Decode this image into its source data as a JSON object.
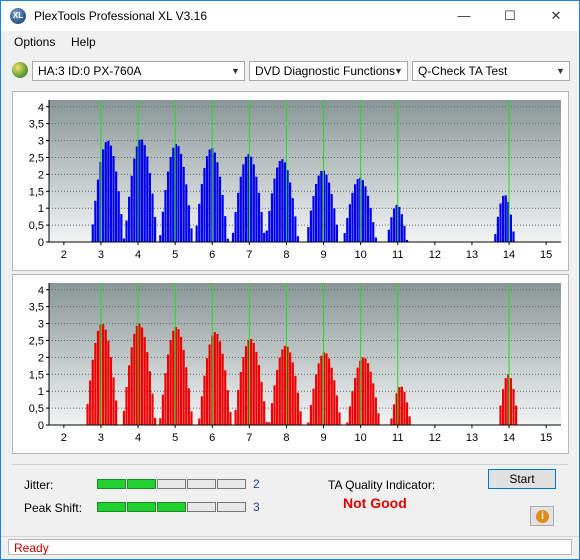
{
  "window": {
    "app_icon_text": "XL",
    "title": "PlexTools Professional XL V3.16",
    "minimize": "—",
    "maximize": "☐",
    "close": "✕"
  },
  "menu": {
    "items": [
      "Options",
      "Help"
    ]
  },
  "toolbar": {
    "drive": "HA:3 ID:0  PX-760A",
    "function": "DVD Diagnostic Functions",
    "test": "Q-Check TA Test"
  },
  "chart_data": [
    {
      "type": "bar",
      "name": "lands",
      "color": "#0000ee",
      "x_ticks": [
        2,
        3,
        4,
        5,
        6,
        7,
        8,
        9,
        10,
        11,
        12,
        13,
        14,
        15
      ],
      "y_ticks": [
        "0",
        "0,5",
        "1",
        "1,5",
        "2",
        "2,5",
        "3",
        "3,5",
        "4"
      ],
      "xlim": [
        1.6,
        15.4
      ],
      "ylim": [
        0,
        4.2
      ],
      "markers": [
        3,
        4,
        5,
        6,
        7,
        8,
        9,
        10,
        11,
        14
      ],
      "peaks": [
        {
          "center": 3.15,
          "height": 3.0
        },
        {
          "center": 4.05,
          "height": 3.05
        },
        {
          "center": 5.0,
          "height": 2.9
        },
        {
          "center": 5.95,
          "height": 2.78
        },
        {
          "center": 6.95,
          "height": 2.6
        },
        {
          "center": 7.85,
          "height": 2.45
        },
        {
          "center": 8.95,
          "height": 2.12
        },
        {
          "center": 9.95,
          "height": 1.9
        },
        {
          "center": 10.95,
          "height": 1.1
        },
        {
          "center": 13.85,
          "height": 1.4
        }
      ]
    },
    {
      "type": "bar",
      "name": "pits",
      "color": "#ee0000",
      "x_ticks": [
        2,
        3,
        4,
        5,
        6,
        7,
        8,
        9,
        10,
        11,
        12,
        13,
        14,
        15
      ],
      "y_ticks": [
        "0",
        "0,5",
        "1",
        "1,5",
        "2",
        "2,5",
        "3",
        "3,5",
        "4"
      ],
      "xlim": [
        1.6,
        15.4
      ],
      "ylim": [
        0,
        4.2
      ],
      "markers": [
        3,
        4,
        5,
        6,
        7,
        8,
        9,
        10,
        11,
        14
      ],
      "peaks": [
        {
          "center": 3.0,
          "height": 3.0
        },
        {
          "center": 4.0,
          "height": 3.0
        },
        {
          "center": 5.0,
          "height": 2.9
        },
        {
          "center": 6.05,
          "height": 2.75
        },
        {
          "center": 7.0,
          "height": 2.55
        },
        {
          "center": 7.95,
          "height": 2.35
        },
        {
          "center": 9.0,
          "height": 2.15
        },
        {
          "center": 10.05,
          "height": 2.0
        },
        {
          "center": 11.05,
          "height": 1.15
        },
        {
          "center": 13.95,
          "height": 1.5
        }
      ]
    }
  ],
  "quality": {
    "jitter_label": "Jitter:",
    "jitter_value": "2",
    "jitter_level": 2,
    "peak_shift_label": "Peak Shift:",
    "peak_shift_value": "3",
    "peak_shift_level": 3,
    "segments": 5,
    "ta_label": "TA Quality Indicator:",
    "ta_value": "Not Good",
    "start_label": "Start",
    "info_glyph": "i"
  },
  "status": {
    "text": "Ready"
  }
}
